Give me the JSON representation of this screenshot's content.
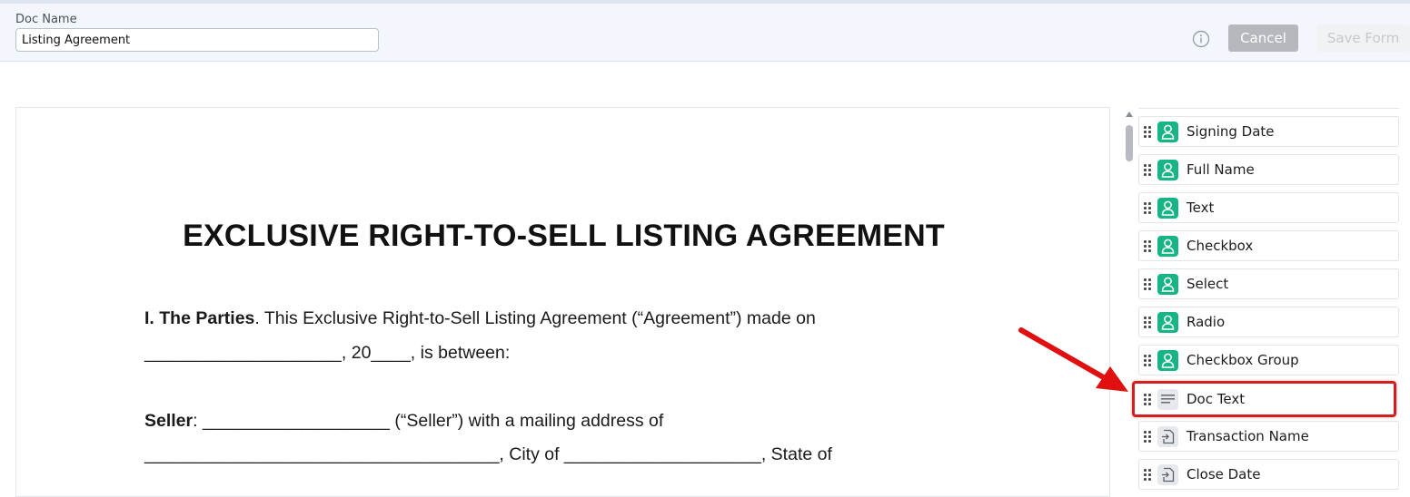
{
  "header": {
    "doc_name_label": "Doc Name",
    "doc_name_value": "Listing Agreement",
    "cancel_label": "Cancel",
    "save_label": "Save Form"
  },
  "document": {
    "title": "EXCLUSIVE RIGHT-TO-SELL LISTING AGREEMENT",
    "parties_heading": "I. The Parties",
    "parties_text": ". This Exclusive Right-to-Sell Listing Agreement (“Agreement”) made on",
    "date_line": "____________________, 20____, is between:",
    "seller_label": "Seller",
    "seller_text": ": ___________________ (“Seller”) with a mailing address of",
    "address_line": "____________________________________, City of ____________________, State of"
  },
  "fields": [
    {
      "label": "Signing Date",
      "icon": "user-icon",
      "highlighted": false
    },
    {
      "label": "Full Name",
      "icon": "user-icon",
      "highlighted": false
    },
    {
      "label": "Text",
      "icon": "user-icon",
      "highlighted": false
    },
    {
      "label": "Checkbox",
      "icon": "user-icon",
      "highlighted": false
    },
    {
      "label": "Select",
      "icon": "user-icon",
      "highlighted": false
    },
    {
      "label": "Radio",
      "icon": "user-icon",
      "highlighted": false
    },
    {
      "label": "Checkbox Group",
      "icon": "user-icon",
      "highlighted": false
    },
    {
      "label": "Doc Text",
      "icon": "text-lines-icon",
      "highlighted": true
    },
    {
      "label": "Transaction Name",
      "icon": "file-import-icon",
      "highlighted": false
    },
    {
      "label": "Close Date",
      "icon": "file-import-icon",
      "highlighted": false
    }
  ],
  "colors": {
    "accent_green": "#17b585",
    "highlight_red": "#d11f1f",
    "cancel_gray": "#b5b8bd"
  }
}
